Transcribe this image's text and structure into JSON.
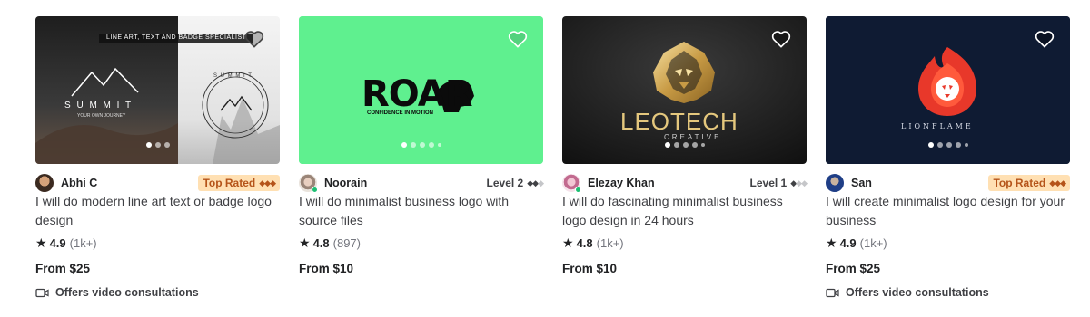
{
  "colors": {
    "thumb1_dark": "#3a3a3a",
    "thumb1_light": "#f2f2f2",
    "thumb2": "#5ff08f",
    "thumb3": "#1d1d1d",
    "thumb4": "#0f1b33",
    "top_rated_bg": "#ffe0b3",
    "top_rated_text": "#b5541a",
    "online_green": "#1dbf73"
  },
  "icons": {
    "favorite": "heart-outline-icon",
    "rating": "star-icon",
    "video": "video-camera-icon",
    "level_diamond": "diamond-icon"
  },
  "cards": [
    {
      "image_text": {
        "banner": "LINE ART, TEXT AND BADGE SPECIALIST",
        "logo": "S U M M I T",
        "tagline": "YOUR OWN JOURNEY",
        "badge_ring": "S U M M I T"
      },
      "seller": "Abhi C",
      "badge": "Top Rated",
      "diamonds_on": "◆◆◆",
      "diamonds_off": "",
      "title": "I will do modern line art text or badge logo design",
      "rating": "4.9",
      "reviews": "(1k+)",
      "price": "From $25",
      "video": "Offers video consultations"
    },
    {
      "image_text": {
        "logo": "ROAR",
        "tagline": "CONFIDENCE IN MOTION"
      },
      "seller": "Noorain",
      "badge": "Level 2",
      "diamonds_on": "◆◆",
      "diamonds_off": "◆",
      "title": "I will do minimalist business logo with source files",
      "rating": "4.8",
      "reviews": "(897)",
      "price": "From $10"
    },
    {
      "image_text": {
        "logo": "LEOTECH",
        "tagline": "CREATIVE"
      },
      "seller": "Elezay Khan",
      "badge": "Level 1",
      "diamonds_on": "◆",
      "diamonds_off": "◆◆",
      "title": "I will do fascinating minimalist business logo design in 24 hours",
      "rating": "4.8",
      "reviews": "(1k+)",
      "price": "From $10"
    },
    {
      "image_text": {
        "logo": "LIONFLAME"
      },
      "seller": "San",
      "badge": "Top Rated",
      "diamonds_on": "◆◆◆",
      "diamonds_off": "",
      "title": "I will create minimalist logo design for your business",
      "rating": "4.9",
      "reviews": "(1k+)",
      "price": "From $25",
      "video": "Offers video consultations"
    }
  ]
}
